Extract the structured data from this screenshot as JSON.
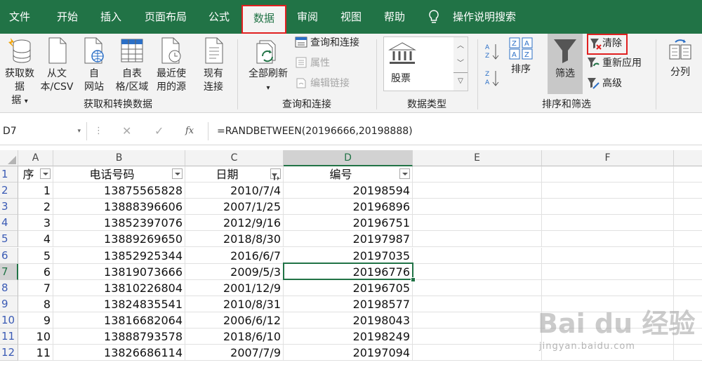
{
  "tabs": [
    "文件",
    "开始",
    "插入",
    "页面布局",
    "公式",
    "数据",
    "审阅",
    "视图",
    "帮助"
  ],
  "tell_me": "操作说明搜索",
  "ribbon": {
    "get_data": "获取数据",
    "get_data_2": "据",
    "from_csv": "从文",
    "from_csv_2": "本/CSV",
    "from_web": "自",
    "from_web_2": "网站",
    "from_table": "自表",
    "from_table_2": "格/区域",
    "recent": "最近使",
    "recent_2": "用的源",
    "existing": "现有",
    "existing_2": "连接",
    "group_get": "获取和转换数据",
    "refresh_all": "全部刷新",
    "queries": "查询和连接",
    "properties": "属性",
    "edit_links": "编辑链接",
    "group_queries": "查询和连接",
    "stocks": "股票",
    "group_types": "数据类型",
    "sort": "排序",
    "filter": "筛选",
    "clear": "清除",
    "reapply": "重新应用",
    "advanced": "高级",
    "group_sort": "排序和筛选",
    "split": "分列"
  },
  "formula_bar": {
    "name_box": "D7",
    "formula": "=RANDBETWEEN(20196666,20198888)"
  },
  "columns": [
    "A",
    "B",
    "C",
    "D",
    "E",
    "F"
  ],
  "headers": [
    "序",
    "电话号码",
    "日期",
    "编号"
  ],
  "rows": [
    {
      "n": "1",
      "a": "",
      "b": "",
      "c": "",
      "d": ""
    },
    {
      "n": "2",
      "a": "1",
      "b": "13875565828",
      "c": "2010/7/4",
      "d": "20198594"
    },
    {
      "n": "3",
      "a": "2",
      "b": "13888396606",
      "c": "2007/1/25",
      "d": "20196896"
    },
    {
      "n": "4",
      "a": "3",
      "b": "13852397076",
      "c": "2012/9/16",
      "d": "20196751"
    },
    {
      "n": "5",
      "a": "4",
      "b": "13889269650",
      "c": "2018/8/30",
      "d": "20197987"
    },
    {
      "n": "6",
      "a": "5",
      "b": "13852925344",
      "c": "2016/6/7",
      "d": "20197035"
    },
    {
      "n": "7",
      "a": "6",
      "b": "13819073666",
      "c": "2009/5/3",
      "d": "20196776"
    },
    {
      "n": "8",
      "a": "7",
      "b": "13810226804",
      "c": "2001/12/9",
      "d": "20196705"
    },
    {
      "n": "9",
      "a": "8",
      "b": "13824835541",
      "c": "2010/8/31",
      "d": "20198577"
    },
    {
      "n": "10",
      "a": "9",
      "b": "13816682064",
      "c": "2006/6/12",
      "d": "20198043"
    },
    {
      "n": "11",
      "a": "10",
      "b": "13888793578",
      "c": "2018/6/10",
      "d": "20198249"
    },
    {
      "n": "12",
      "a": "11",
      "b": "13826686114",
      "c": "2007/7/9",
      "d": "20197094"
    }
  ],
  "watermark": "Bai du 经验",
  "watermark_url": "jingyan.baidu.com",
  "colors": {
    "accent": "#217346",
    "highlight": "#e02020"
  }
}
